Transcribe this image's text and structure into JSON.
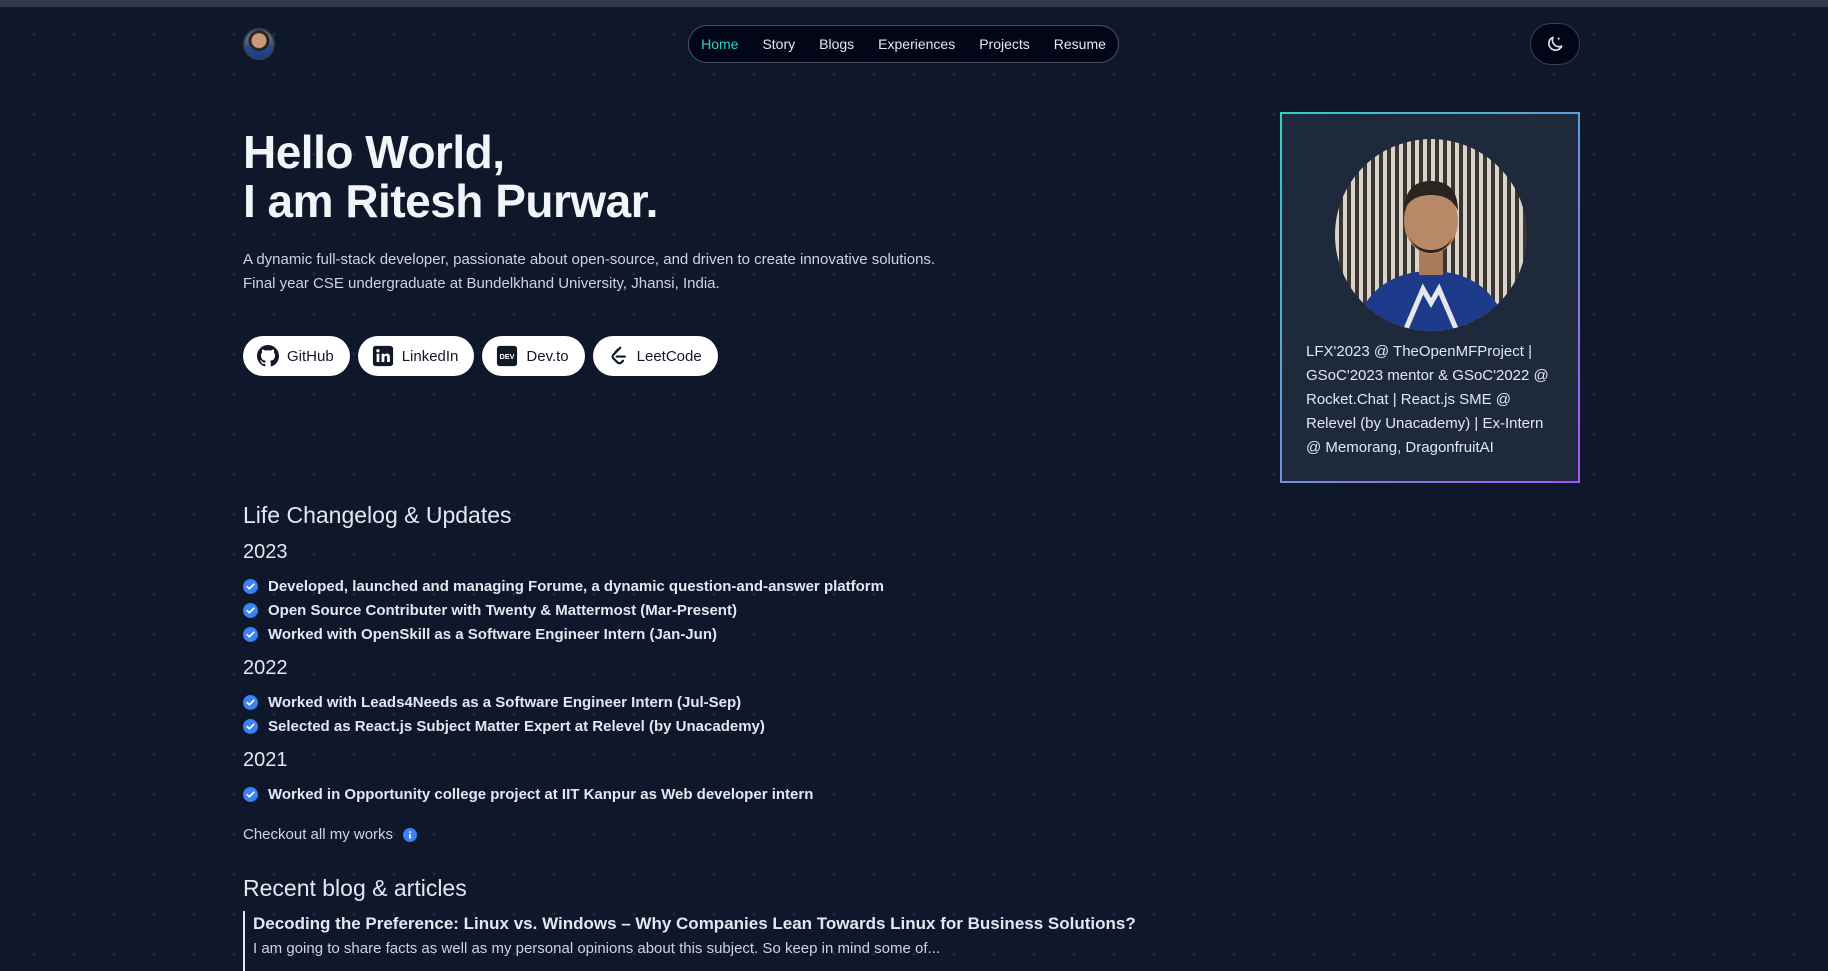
{
  "nav": {
    "items": [
      {
        "label": "Home",
        "active": true
      },
      {
        "label": "Story"
      },
      {
        "label": "Blogs"
      },
      {
        "label": "Experiences"
      },
      {
        "label": "Projects"
      },
      {
        "label": "Resume"
      }
    ]
  },
  "hero": {
    "greeting": "Hello World,",
    "name_line": "I am Ritesh Purwar.",
    "desc_line1": "A dynamic full-stack developer, passionate about open-source, and driven to create innovative solutions.",
    "desc_line2": "Final year CSE undergraduate at Bundelkhand University, Jhansi, India."
  },
  "socials": [
    {
      "label": "GitHub",
      "icon": "github-icon"
    },
    {
      "label": "LinkedIn",
      "icon": "linkedin-icon"
    },
    {
      "label": "Dev.to",
      "icon": "devto-icon"
    },
    {
      "label": "LeetCode",
      "icon": "leetcode-icon"
    }
  ],
  "profile_card": {
    "bio": "LFX'2023 @ TheOpenMFProject | GSoC'2023 mentor & GSoC'2022 @ Rocket.Chat | React.js SME @ Relevel (by Unacademy) | Ex-Intern @ Memorang, DragonfruitAI"
  },
  "changelog": {
    "title": "Life Changelog & Updates",
    "years": [
      {
        "year": "2023",
        "items": [
          "Developed, launched and managing Forume, a dynamic question-and-answer platform",
          "Open Source Contributer with Twenty & Mattermost (Mar-Present)",
          "Worked with OpenSkill as a Software Engineer Intern (Jan-Jun)"
        ]
      },
      {
        "year": "2022",
        "items": [
          "Worked with Leads4Needs as a Software Engineer Intern (Jul-Sep)",
          "Selected as React.js Subject Matter Expert at Relevel (by Unacademy)"
        ]
      },
      {
        "year": "2021",
        "items": [
          "Worked in Opportunity college project at IIT Kanpur as Web developer intern"
        ]
      }
    ],
    "checkout_label": "Checkout all my works"
  },
  "blogs": {
    "title": "Recent blog & articles",
    "posts": [
      {
        "title": "Decoding the Preference: Linux vs. Windows – Why Companies Lean Towards Linux for Business Solutions?",
        "excerpt": "I am going to share facts as well as my personal opinions about this subject. So keep in mind some of..."
      }
    ]
  },
  "colors": {
    "background": "#0f172a",
    "accent_teal": "#2dd4bf",
    "accent_blue": "#3b82f6",
    "card_border_start": "#2dd4bf",
    "card_border_end": "#a855f7"
  }
}
